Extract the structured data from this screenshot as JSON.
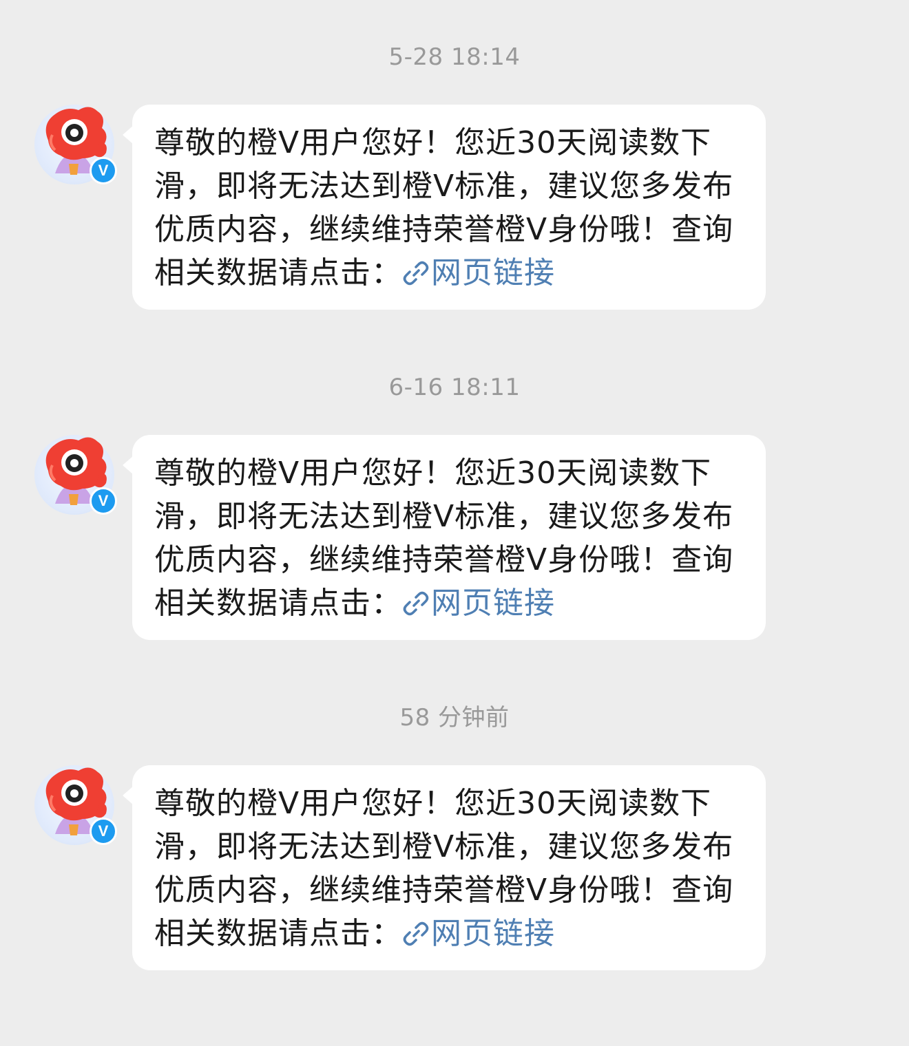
{
  "messages": [
    {
      "timestamp": "5-28 18:14",
      "text": "尊敬的橙V用户您好！您近30天阅读数下滑，即将无法达到橙V标准，建议您多发布优质内容，继续维持荣誉橙V身份哦！查询相关数据请点击：",
      "link_label": "网页链接"
    },
    {
      "timestamp": "6-16 18:11",
      "text": "尊敬的橙V用户您好！您近30天阅读数下滑，即将无法达到橙V标准，建议您多发布优质内容，继续维持荣誉橙V身份哦！查询相关数据请点击：",
      "link_label": "网页链接"
    },
    {
      "timestamp": "58 分钟前",
      "text": "尊敬的橙V用户您好！您近30天阅读数下滑，即将无法达到橙V标准，建议您多发布优质内容，继续维持荣誉橙V身份哦！查询相关数据请点击：",
      "link_label": "网页链接"
    }
  ],
  "avatar": {
    "badge_label": "V",
    "icon": "weibo-mascot-avatar"
  },
  "colors": {
    "background": "#ededed",
    "bubble": "#ffffff",
    "link": "#4f7fb3",
    "timestamp": "#999999",
    "badge": "#1d9bf0"
  }
}
